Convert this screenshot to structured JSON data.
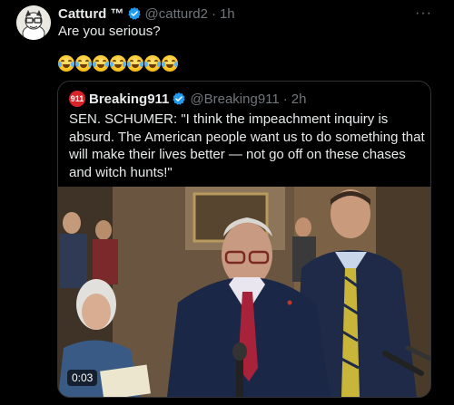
{
  "tweet": {
    "name": "Catturd ™",
    "handle": "@catturd2",
    "separator": "·",
    "time": "1h",
    "text": "Are you serious?",
    "emoji_count": 7,
    "emoji": "face-with-tears-of-joy",
    "more_label": "···"
  },
  "quoted": {
    "avatar_text": "911",
    "name": "Breaking911",
    "handle": "@Breaking911",
    "separator": "·",
    "time": "2h",
    "text": "SEN. SCHUMER: \"I think the impeachment inquiry is absurd. The American people want us to do something that will make their lives better — not go off on these chases and witch hunts!\"",
    "video": {
      "timestamp": "0:03"
    }
  },
  "colors": {
    "verified": "#1d9bf0",
    "background": "#000000",
    "muted": "#71767b"
  }
}
